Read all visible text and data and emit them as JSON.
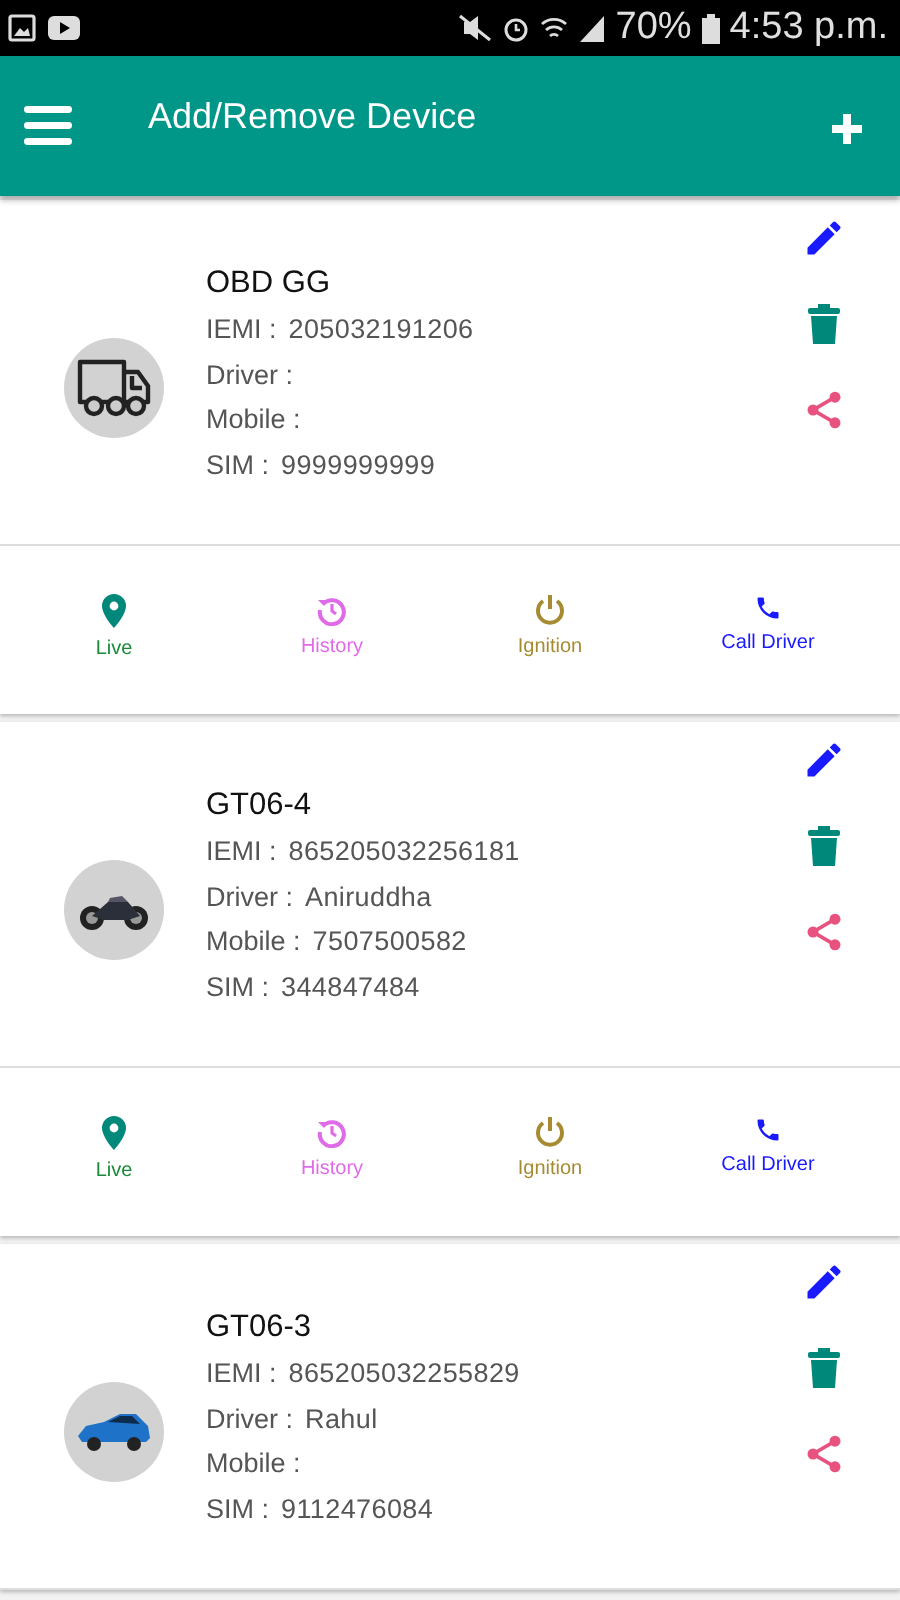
{
  "status_bar": {
    "battery": "70%",
    "time": "4:53 p.m."
  },
  "app_bar": {
    "title": "Add/Remove Device"
  },
  "devices": [
    {
      "name": "OBD GG",
      "vehicle": {
        "kind": "truck"
      },
      "fields": [
        {
          "label": "IEMI :",
          "value": "205032191206"
        },
        {
          "label": "Driver :"
        },
        {
          "label": "Mobile :"
        },
        {
          "label": "SIM :",
          "value": "9999999999"
        }
      ],
      "actions": [
        {
          "kind": "live",
          "label": "Live",
          "color": "#1b8a3a"
        },
        {
          "kind": "history",
          "label": "History",
          "color": "#e06be8"
        },
        {
          "kind": "ignition",
          "label": "Ignition",
          "color": "#a68b33"
        },
        {
          "kind": "call",
          "label": "Call Driver",
          "color": "#1a1aff"
        }
      ]
    },
    {
      "name": "GT06-4",
      "vehicle": {
        "kind": "motorcycle"
      },
      "fields": [
        {
          "label": "IEMI :",
          "value": "865205032256181"
        },
        {
          "label": "Driver :",
          "value": "Aniruddha"
        },
        {
          "label": "Mobile :",
          "value": "7507500582"
        },
        {
          "label": "SIM :",
          "value": "344847484"
        }
      ],
      "actions": [
        {
          "kind": "live",
          "label": "Live",
          "color": "#1b8a3a"
        },
        {
          "kind": "history",
          "label": "History",
          "color": "#e06be8"
        },
        {
          "kind": "ignition",
          "label": "Ignition",
          "color": "#a68b33"
        },
        {
          "kind": "call",
          "label": "Call Driver",
          "color": "#1a1aff"
        }
      ]
    },
    {
      "name": "GT06-3",
      "vehicle": {
        "kind": "car"
      },
      "fields": [
        {
          "label": "IEMI :",
          "value": "865205032255829"
        },
        {
          "label": "Driver :",
          "value": "Rahul"
        },
        {
          "label": "Mobile :"
        },
        {
          "label": "SIM :",
          "value": "9112476084"
        }
      ]
    }
  ]
}
